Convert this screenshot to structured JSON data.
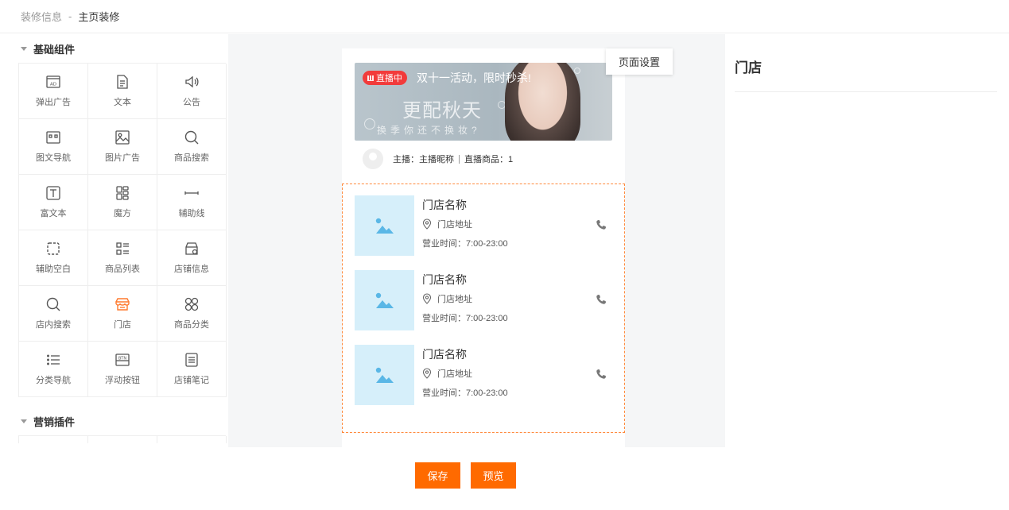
{
  "breadcrumb": {
    "parent": "装修信息",
    "separator": "-",
    "current": "主页装修"
  },
  "sidebar": {
    "basic_title": "基础组件",
    "marketing_title": "营销插件",
    "components": [
      {
        "label": "弹出广告",
        "icon": "ad-icon"
      },
      {
        "label": "文本",
        "icon": "document-icon"
      },
      {
        "label": "公告",
        "icon": "speaker-icon"
      },
      {
        "label": "图文导航",
        "icon": "image-nav-icon"
      },
      {
        "label": "图片广告",
        "icon": "image-icon"
      },
      {
        "label": "商品搜索",
        "icon": "search-icon"
      },
      {
        "label": "富文本",
        "icon": "text-box-icon"
      },
      {
        "label": "魔方",
        "icon": "cube-grid-icon"
      },
      {
        "label": "辅助线",
        "icon": "line-icon"
      },
      {
        "label": "辅助空白",
        "icon": "blank-icon"
      },
      {
        "label": "商品列表",
        "icon": "list-icon"
      },
      {
        "label": "店铺信息",
        "icon": "shop-info-icon"
      },
      {
        "label": "店内搜索",
        "icon": "search-icon"
      },
      {
        "label": "门店",
        "icon": "store-icon"
      },
      {
        "label": "商品分类",
        "icon": "category-icon"
      },
      {
        "label": "分类导航",
        "icon": "menu-list-icon"
      },
      {
        "label": "浮动按钮",
        "icon": "btn-icon"
      },
      {
        "label": "店铺笔记",
        "icon": "note-icon"
      }
    ]
  },
  "preview": {
    "live": {
      "badge": "直播中",
      "title": "双十一活动，限时秒杀!",
      "deco_main": "更配秋天",
      "deco_sub": "换季你还不换妆?",
      "anchor_text": "主播：主播昵称",
      "goods_text": "直播商品：1"
    },
    "stores": [
      {
        "name": "门店名称",
        "address": "门店地址",
        "hours": "营业时间：7:00-23:00"
      },
      {
        "name": "门店名称",
        "address": "门店地址",
        "hours": "营业时间：7:00-23:00"
      },
      {
        "name": "门店名称",
        "address": "门店地址",
        "hours": "营业时间：7:00-23:00"
      }
    ],
    "page_settings": "页面设置"
  },
  "panel": {
    "title": "门店"
  },
  "actions": {
    "save": "保存",
    "preview": "预览"
  },
  "colors": {
    "accent": "#ff6a00",
    "active_icon": "#ff7a2e",
    "live_badge": "#f23b3b",
    "thumb_bg": "#d6effa"
  }
}
